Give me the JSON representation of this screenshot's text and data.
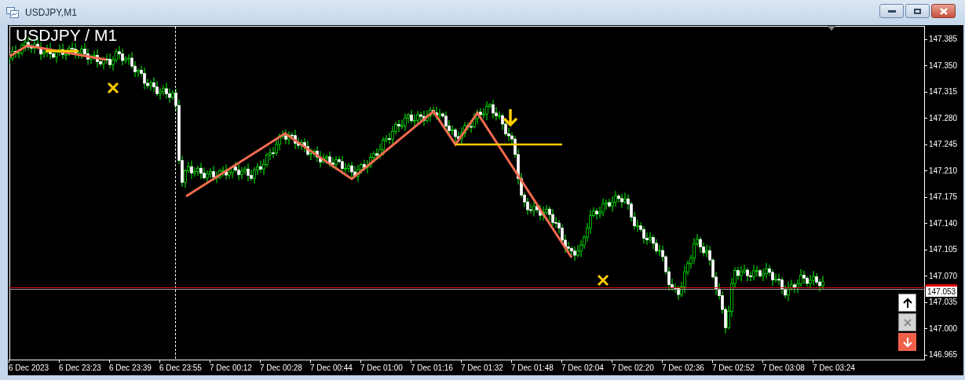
{
  "window": {
    "title": "USDJPY,M1"
  },
  "chart": {
    "title": "USDJPY / M1",
    "current_price": "147.053",
    "y_axis": [
      "147.385",
      "147.350",
      "147.315",
      "147.280",
      "147.245",
      "147.210",
      "147.175",
      "147.140",
      "147.105",
      "147.070",
      "147.035",
      "147.000",
      "146.965"
    ],
    "x_axis": [
      "6 Dec 2023",
      "6 Dec 23:23",
      "6 Dec 23:39",
      "6 Dec 23:55",
      "7 Dec 00:12",
      "7 Dec 00:28",
      "7 Dec 00:44",
      "7 Dec 01:00",
      "7 Dec 01:16",
      "7 Dec 01:32",
      "7 Dec 01:48",
      "7 Dec 02:04",
      "7 Dec 02:20",
      "7 Dec 02:36",
      "7 Dec 02:52",
      "7 Dec 03:08",
      "7 Dec 03:24"
    ]
  }
}
